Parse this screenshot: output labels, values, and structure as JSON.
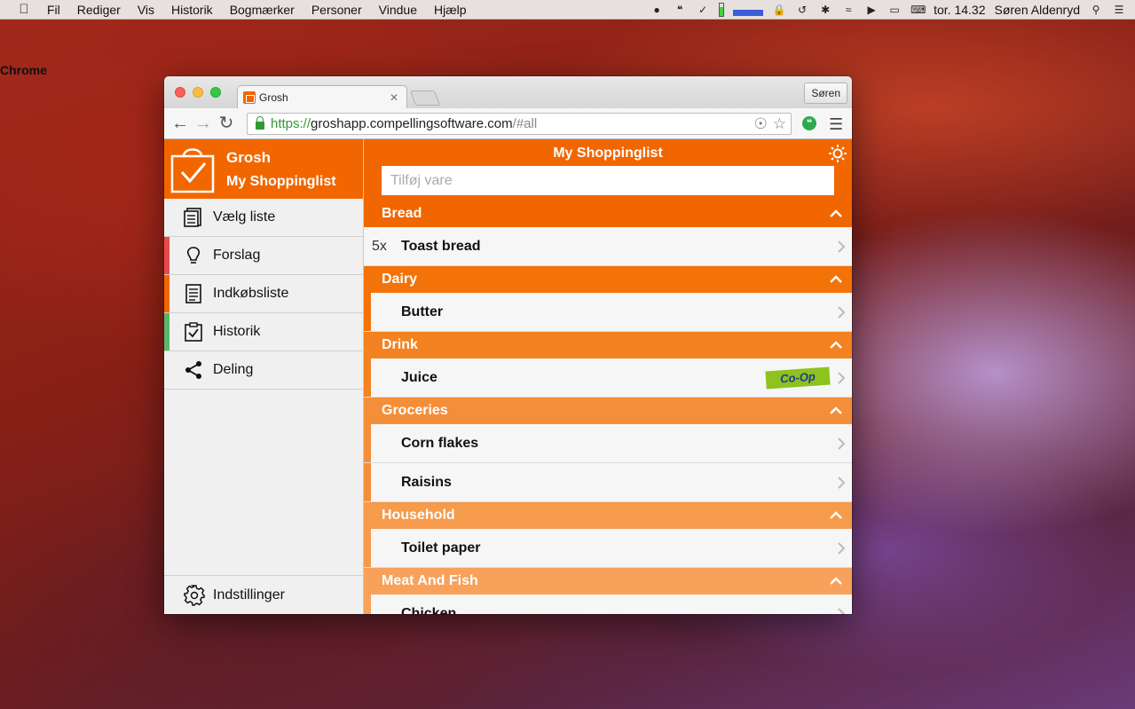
{
  "menubar": {
    "app_name": "Chrome",
    "items": [
      "Fil",
      "Rediger",
      "Vis",
      "Historik",
      "Bogmærker",
      "Personer",
      "Vindue",
      "Hjælp"
    ],
    "clock": "tor. 14.32",
    "user": "Søren Aldenryd"
  },
  "browser": {
    "tab_title": "Grosh",
    "profile_button": "Søren",
    "url": {
      "scheme": "https://",
      "host": "groshapp.compellingsoftware.com",
      "path": "/#all"
    }
  },
  "sidebar": {
    "brand": "Grosh",
    "current_list": "My Shoppinglist",
    "items": [
      {
        "label": "Vælg liste",
        "icon": "list-icon",
        "accent": ""
      },
      {
        "label": "Forslag",
        "icon": "lightbulb-icon",
        "accent": "#e84a4a"
      },
      {
        "label": "Indkøbsliste",
        "icon": "document-icon",
        "accent": "#f26600"
      },
      {
        "label": "Historik",
        "icon": "clipboard-check-icon",
        "accent": "#5bb56a"
      },
      {
        "label": "Deling",
        "icon": "share-icon",
        "accent": ""
      }
    ],
    "settings_label": "Indstillinger"
  },
  "main": {
    "title": "My Shoppinglist",
    "add_placeholder": "Tilføj vare",
    "groups": [
      {
        "name": "Bread",
        "color": "#f26600",
        "items": [
          {
            "qty": "5x",
            "name": "Toast bread",
            "badge": ""
          }
        ]
      },
      {
        "name": "Dairy",
        "color": "#f37308",
        "items": [
          {
            "qty": "",
            "name": "Butter",
            "badge": ""
          }
        ]
      },
      {
        "name": "Drink",
        "color": "#f48220",
        "items": [
          {
            "qty": "",
            "name": "Juice",
            "badge": "Co-Op"
          }
        ]
      },
      {
        "name": "Groceries",
        "color": "#f58e38",
        "items": [
          {
            "qty": "",
            "name": "Corn flakes",
            "badge": ""
          },
          {
            "qty": "",
            "name": "Raisins",
            "badge": ""
          }
        ]
      },
      {
        "name": "Household",
        "color": "#f69a4c",
        "items": [
          {
            "qty": "",
            "name": "Toilet paper",
            "badge": ""
          }
        ]
      },
      {
        "name": "Meat And Fish",
        "color": "#f7a15a",
        "items": [
          {
            "qty": "",
            "name": "Chicken",
            "badge": ""
          }
        ]
      }
    ]
  }
}
